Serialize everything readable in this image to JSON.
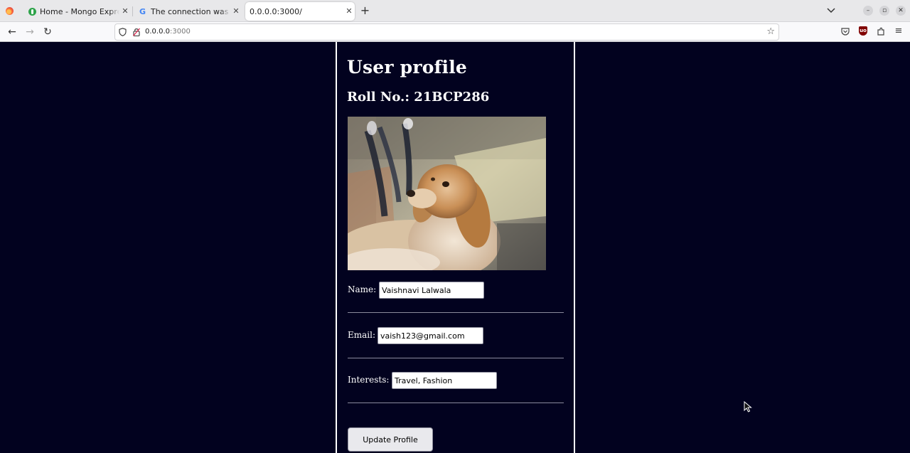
{
  "browser": {
    "tabs": [
      {
        "title": "Home - Mongo Express",
        "favicon": "mongo-leaf-icon",
        "active": false
      },
      {
        "title": "The connection was reset",
        "favicon": "google-g-icon",
        "active": false
      },
      {
        "title": "0.0.0.0:3000/",
        "favicon": "",
        "active": true
      }
    ],
    "url_host": "0.0.0.0",
    "url_port": ":3000"
  },
  "page": {
    "title": "User profile",
    "roll_no": "Roll No.: 21BCP286",
    "photo": {
      "alt": "dog-photo",
      "description_icon": "dog-photo"
    },
    "fields": {
      "name": {
        "label": "Name:",
        "value": "Vaishnavi Lalwala"
      },
      "email": {
        "label": "Email:",
        "value": "vaish123@gmail.com"
      },
      "interests": {
        "label": "Interests:",
        "value": "Travel, Fashion"
      }
    },
    "update_button": "Update Profile"
  },
  "colors": {
    "page_background": "#02021f",
    "column_border": "#ffffff",
    "text": "#ffffff"
  }
}
